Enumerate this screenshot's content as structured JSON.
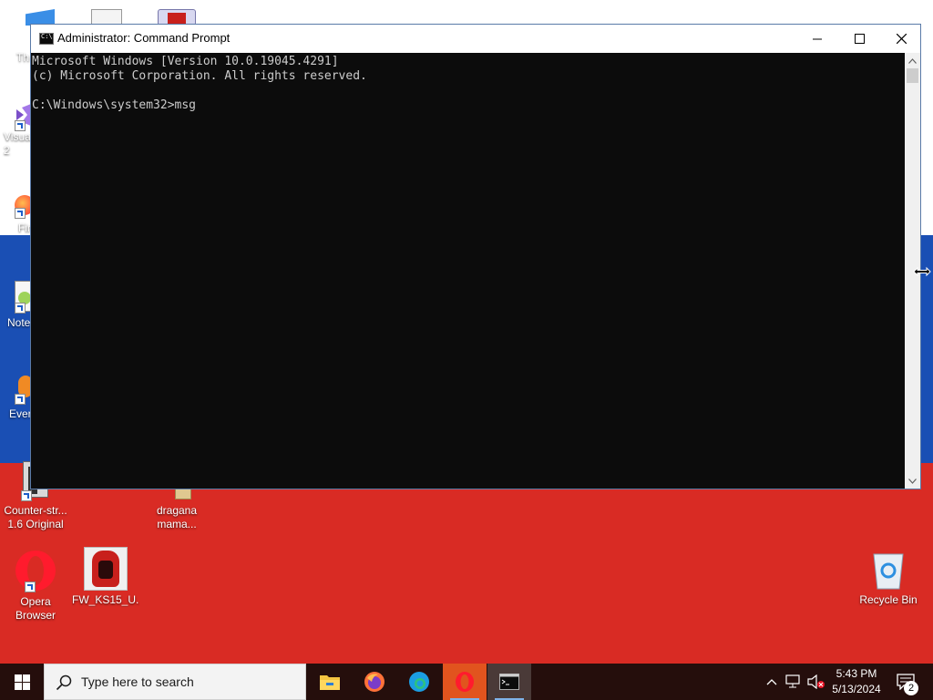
{
  "desktop": {
    "icons": [
      {
        "label": "Th",
        "name": "desktop-icon-this-pc"
      },
      {
        "label": "Visua 2",
        "name": "desktop-icon-visual-studio"
      },
      {
        "label": "Fir",
        "name": "desktop-icon-firefox"
      },
      {
        "label": "Note",
        "name": "desktop-icon-notepad-plus"
      },
      {
        "label": "Ever",
        "name": "desktop-icon-everything"
      },
      {
        "label": "Counter-str...\n1.6 Original",
        "name": "desktop-icon-counter-strike"
      },
      {
        "label": "dragana\nmama...",
        "name": "desktop-icon-dragana-mama"
      },
      {
        "label": "Opera\nBrowser",
        "name": "desktop-icon-opera"
      },
      {
        "label": "FW_KS15_U...",
        "name": "desktop-icon-fw-ks15"
      },
      {
        "label": "Recycle Bin",
        "name": "desktop-icon-recycle-bin"
      }
    ]
  },
  "window": {
    "title": "Administrator: Command Prompt",
    "icon_text": "C:\\.",
    "console_lines": [
      "Microsoft Windows [Version 10.0.19045.4291]",
      "(c) Microsoft Corporation. All rights reserved.",
      "",
      "C:\\Windows\\system32>msg"
    ]
  },
  "taskbar": {
    "search_placeholder": "Type here to search",
    "time": "5:43 PM",
    "date": "5/13/2024",
    "notification_count": "2",
    "apps": [
      "file-explorer",
      "firefox",
      "edge",
      "opera",
      "command-prompt"
    ]
  },
  "colors": {
    "desktop_blue": "#1a4fb4",
    "desktop_red": "#d92b24",
    "console_bg": "#0c0c0c",
    "console_text": "#cccccc",
    "taskbar_bg": "#250e0c"
  }
}
